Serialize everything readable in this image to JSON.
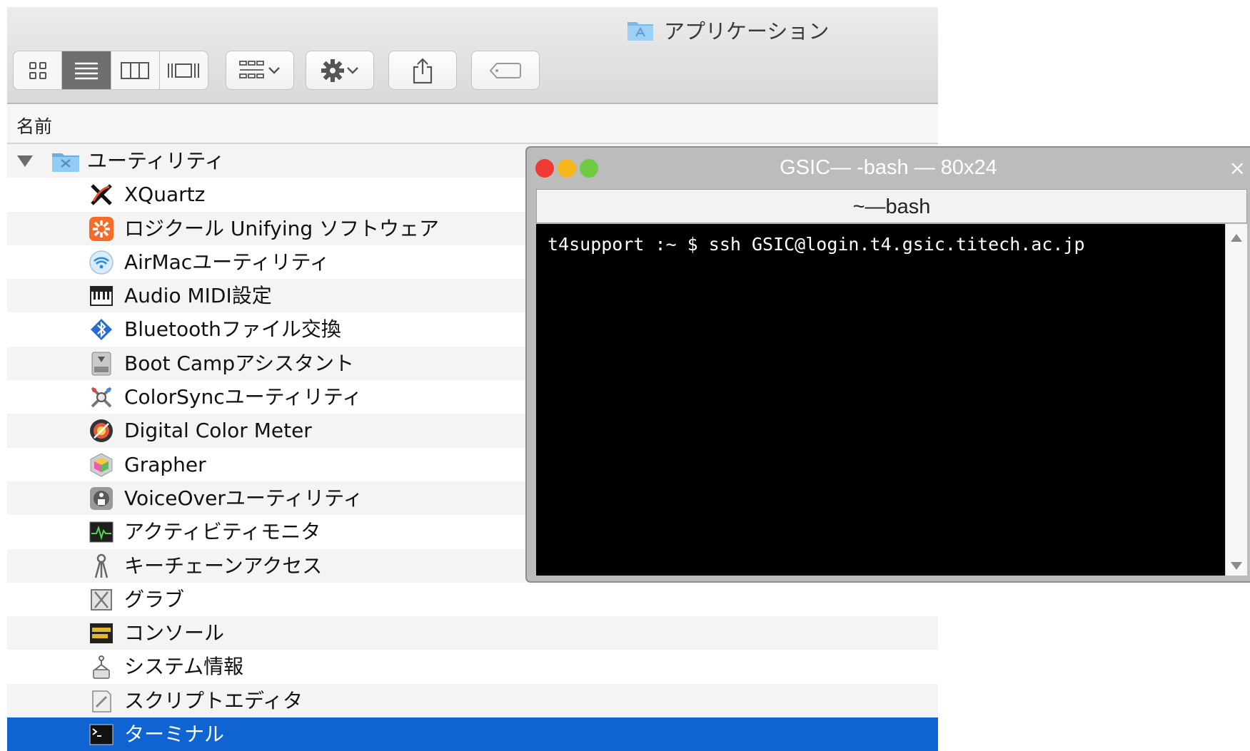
{
  "finder": {
    "window_title": "アプリケーション",
    "column_header": "名前",
    "folder": {
      "label": "ユーティリティ",
      "icon": "utilities-folder-icon",
      "expanded": true
    },
    "items": [
      {
        "label": "XQuartz",
        "icon": "xquartz-icon"
      },
      {
        "label": "ロジクール Unifying ソフトウェア",
        "icon": "logitech-unifying-icon"
      },
      {
        "label": "AirMacユーティリティ",
        "icon": "airmac-icon"
      },
      {
        "label": "Audio MIDI設定",
        "icon": "audio-midi-icon"
      },
      {
        "label": "Bluetoothファイル交換",
        "icon": "bluetooth-icon"
      },
      {
        "label": "Boot Campアシスタント",
        "icon": "bootcamp-icon"
      },
      {
        "label": "ColorSyncユーティリティ",
        "icon": "colorsync-icon"
      },
      {
        "label": "Digital Color Meter",
        "icon": "color-meter-icon"
      },
      {
        "label": "Grapher",
        "icon": "grapher-icon"
      },
      {
        "label": "VoiceOverユーティリティ",
        "icon": "voiceover-icon"
      },
      {
        "label": "アクティビティモニタ",
        "icon": "activity-monitor-icon"
      },
      {
        "label": "キーチェーンアクセス",
        "icon": "keychain-icon"
      },
      {
        "label": "グラブ",
        "icon": "grab-icon"
      },
      {
        "label": "コンソール",
        "icon": "console-icon"
      },
      {
        "label": "システム情報",
        "icon": "system-info-icon"
      },
      {
        "label": "スクリプトエディタ",
        "icon": "script-editor-icon"
      },
      {
        "label": "ターミナル",
        "icon": "terminal-icon",
        "selected": true
      }
    ],
    "colors": {
      "selection": "#0f64d2"
    }
  },
  "terminal": {
    "window_title": "GSIC— -bash — 80x24",
    "tab_title": "~—bash",
    "close_glyph": "×",
    "prompt_line": "t4support :~ $ ssh GSIC@login.t4.gsic.titech.ac.jp",
    "colors": {
      "close": "#f03b34",
      "minimize": "#f6b61c",
      "zoom": "#6fcb43"
    }
  }
}
